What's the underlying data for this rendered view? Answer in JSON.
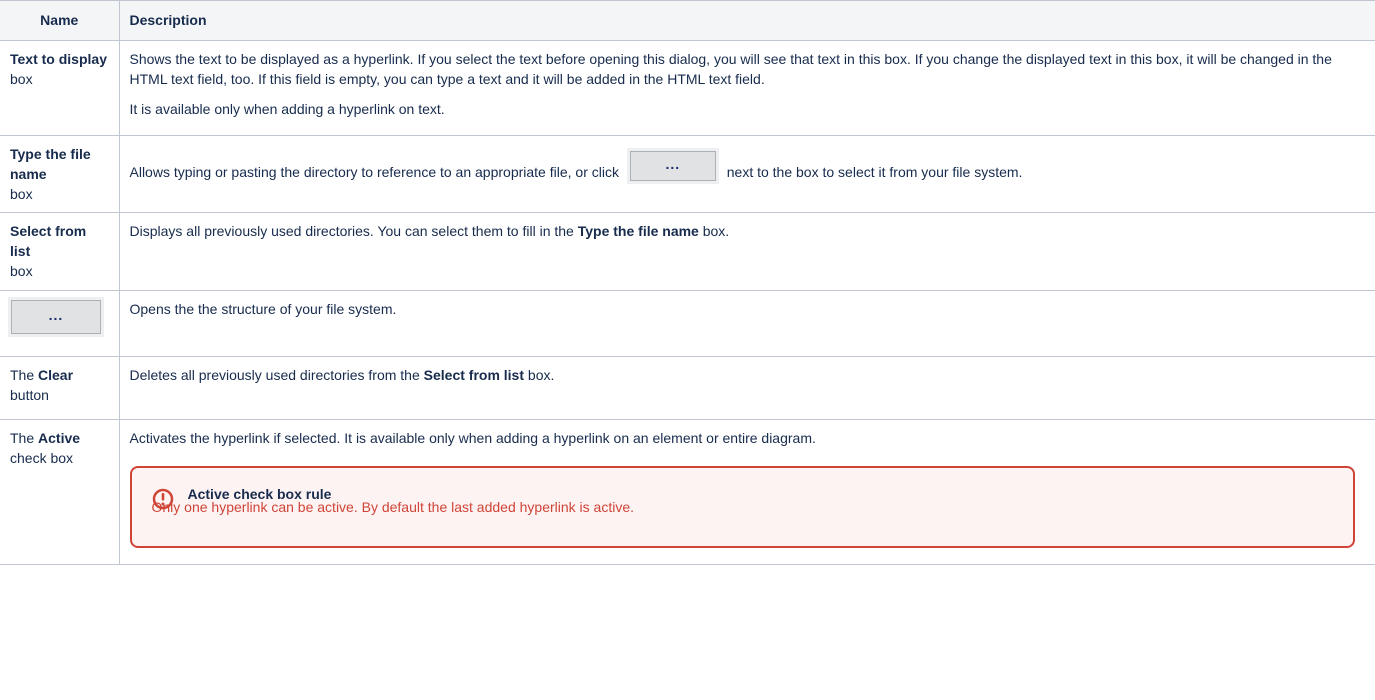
{
  "headers": {
    "name": "Name",
    "description": "Description"
  },
  "rows": {
    "text_to_display": {
      "name_bold": "Text to display",
      "name_rest": "box",
      "desc_p1": "Shows the text to be displayed as a hyperlink. If you select the text before opening this dialog, you will see that text in this box. If you change the displayed text in this box, it will be changed in the HTML text field, too. If this field is empty, you can type a text and it will be added in the HTML text field.",
      "desc_p2": "It is available only when adding a hyperlink on text."
    },
    "type_file_name": {
      "name_bold": "Type the file name",
      "name_rest": "box",
      "desc_before": "Allows typing or pasting the directory to reference to an appropriate file, or click",
      "button_label": "...",
      "desc_after": "next to the box to select it from your file system."
    },
    "select_from_list": {
      "name_bold": "Select from list",
      "name_rest": "box",
      "desc_before": "Displays all previously used directories. You can select them to fill in the",
      "desc_bold": "Type the file name",
      "desc_after": "box."
    },
    "browse_button": {
      "button_label": "...",
      "desc": "Opens the the structure of your file system."
    },
    "clear": {
      "name_pre": "The",
      "name_bold": "Clear",
      "name_rest": "button",
      "desc_before": "Deletes all previously used directories from the",
      "desc_bold": "Select from list",
      "desc_after": "box."
    },
    "active": {
      "name_pre": "The",
      "name_bold": "Active",
      "name_rest": "check box",
      "desc": "Activates the hyperlink if selected. It is available only when adding a hyperlink on an element or entire diagram.",
      "warning_title": "Active check box rule",
      "warning_text": "Only one hyperlink can be active. By default the last added hyperlink is active."
    }
  },
  "colors": {
    "warning_border": "#d04437",
    "warning_bg": "#fdf3f3",
    "header_bg": "#f4f5f7"
  },
  "icons": {
    "warning": "warning-circle-icon",
    "button": "ellipsis-button-icon"
  }
}
